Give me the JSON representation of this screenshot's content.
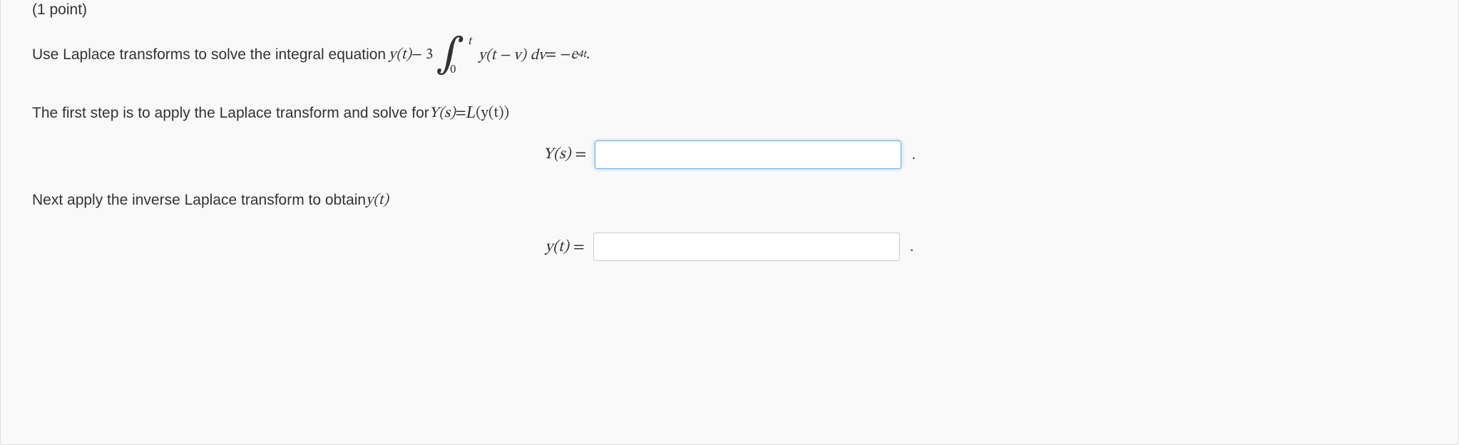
{
  "header": {
    "points_label": "(1 point)"
  },
  "problem": {
    "intro_text": "Use Laplace transforms to solve the integral equation ",
    "eq_y_of_t": "y(t)",
    "eq_minus_3": " − 3",
    "int_upper": "t",
    "int_lower": "0",
    "integrand_y": "y(t − v)",
    "integrand_dv": " dv",
    "eq_equals": " = −",
    "eq_e": "e",
    "eq_exp": "4t",
    "eq_final_period": " ."
  },
  "step1": {
    "text_a": "The first step is to apply the Laplace transform and solve for ",
    "Ys": "Y(s)",
    "eq": " = ",
    "script_L": "L",
    "paren_y": "(y(t))"
  },
  "input1": {
    "label_Y": "Y(s)",
    "label_eq": " = ",
    "value": "",
    "period": "."
  },
  "step2": {
    "text": "Next apply the inverse Laplace transform to obtain ",
    "yt": "y(t)"
  },
  "input2": {
    "label_y": "y(t)",
    "label_eq": " = ",
    "value": "",
    "period": "."
  }
}
